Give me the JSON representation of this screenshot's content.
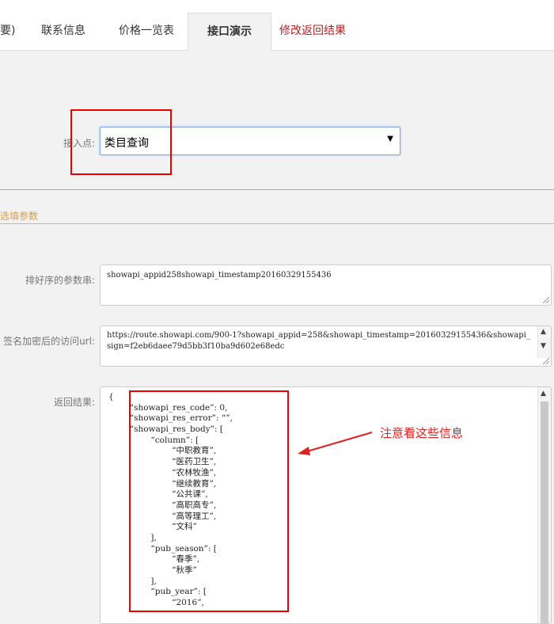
{
  "tabs": [
    {
      "label": "要)"
    },
    {
      "label": "联系信息"
    },
    {
      "label": "价格一览表"
    },
    {
      "label": "接口演示"
    },
    {
      "label": "修改返回结果"
    }
  ],
  "access_point": {
    "label": "接入点:",
    "selected": "类目查询"
  },
  "optional_section": {
    "title": "选填参数"
  },
  "sorted_params": {
    "label": "排好序的参数串:",
    "value": "showapi_appid258showapi_timestamp20160329155436"
  },
  "signed_url": {
    "label": "签名加密后的访问url:",
    "value": "https://route.showapi.com/900-1?showapi_appid=258&showapi_timestamp=20160329155436&showapi_sign=f2eb6daee79d5bb3f10ba9d602e68edc"
  },
  "result": {
    "label": "返回结果:",
    "lines": [
      "{",
      "        “showapi_res_code”: 0,",
      "        “showapi_res_error”: “”,",
      "        “showapi_res_body”: [",
      "                “column”: [",
      "                        “中职教育”,",
      "                        “医药卫生”,",
      "                        “农林牧渔”,",
      "                        “继续教育”,",
      "                        “公共课”,",
      "                        “高职高专”,",
      "                        “高等理工”,",
      "                        “文科”",
      "                ],",
      "                “pub_season”: [",
      "                        “春季”,",
      "                        “秋季”",
      "                ],",
      "                “pub_year”: [",
      "                        “2016”,"
    ]
  },
  "annotation": {
    "text": "注意看这些信息",
    "color": "#dd2222"
  },
  "colors": {
    "highlight": "#ee0000",
    "section_title": "#e69a3a",
    "active_tab_text": "#333333"
  }
}
